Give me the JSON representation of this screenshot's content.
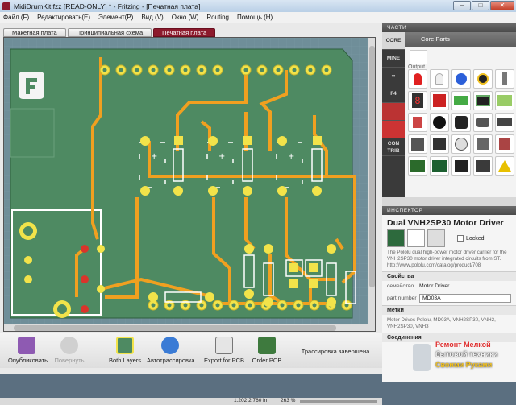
{
  "window": {
    "title": "MidiDrumKit.fzz [READ-ONLY] * - Fritzing - [Печатная плата]",
    "minimize": "–",
    "maximize": "□",
    "close": "✕"
  },
  "menu": [
    "Файл (F)",
    "Редактировать(E)",
    "Элемент(P)",
    "Вид (V)",
    "Окно (W)",
    "Routing",
    "Помощь (H)"
  ],
  "tabs": [
    "Макетная плата",
    "Принципиальная схема",
    "Печатная плата"
  ],
  "active_tab": 2,
  "toolbar": {
    "share": "Опубликовать",
    "rotate": "Повернуть",
    "layers": "Both Layers",
    "autoroute": "Автотрассировка",
    "export": "Export for PCB",
    "order": "Order PCB",
    "status": "Трассировка завершена"
  },
  "statusbar": {
    "coords": "1.202 2.760 in",
    "zoom": "263 %"
  },
  "parts": {
    "header": "ЧАСТИ",
    "bin_title": "Core Parts",
    "section_label": "Output",
    "side_tabs": [
      "CORE",
      "MINE",
      "∞",
      "F4",
      "",
      "",
      "CON TRIB"
    ]
  },
  "inspector": {
    "header": "ИНСПЕКТОР",
    "title": "Dual VNH2SP30 Motor Driver",
    "locked_label": "Locked",
    "description": "The Pololu dual high-power motor driver carrier for the VNH2SP30 motor driver integrated circuits from ST. http://www.pololu.com/catalog/product/708",
    "props_header": "Свойства",
    "props": [
      {
        "key": "семейство",
        "value": "Motor Driver"
      },
      {
        "key": "part number",
        "value": "MD03A"
      }
    ],
    "tags_header": "Метки",
    "tags": "Motor Drives Pololu, MD03A, VNH2SP30, VNH2, VNH2SP30, VNH3",
    "conn_header": "Соединения"
  },
  "watermark": {
    "line1": "Ремонт",
    "line1b": "Мелкой",
    "line2": "бытовой техники",
    "line3": "Своими Руками"
  },
  "colors": {
    "accent": "#8c1a2c",
    "pcb": "#4e8a62",
    "trace": "#f0a020",
    "pad": "#f2e34a"
  }
}
